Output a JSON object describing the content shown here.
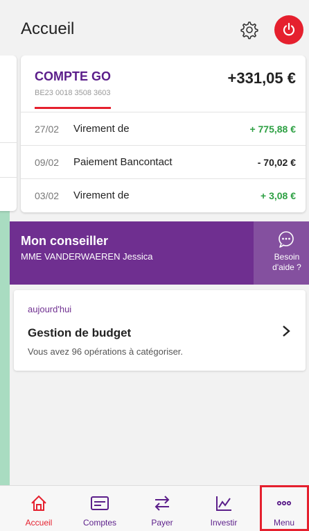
{
  "header": {
    "title": "Accueil",
    "settings_icon": "gear-icon",
    "logout_icon": "power-icon"
  },
  "account": {
    "name": "COMPTE GO",
    "iban": "BE23 0018 3508 3603",
    "balance": "+331,05 €",
    "transactions": [
      {
        "date": "27/02",
        "label": "Virement de",
        "amount": "+ 775,88 €",
        "sign": "positive"
      },
      {
        "date": "09/02",
        "label": "Paiement Bancontact",
        "amount": "- 70,02 €",
        "sign": "negative"
      },
      {
        "date": "03/02",
        "label": "Virement de",
        "amount": "+ 3,08 €",
        "sign": "positive"
      }
    ]
  },
  "advisor": {
    "title": "Mon conseiller",
    "name": "MME VANDERWAEREN Jessica",
    "help_label_line1": "Besoin",
    "help_label_line2": "d'aide ?"
  },
  "budget": {
    "when": "aujourd'hui",
    "title": "Gestion de budget",
    "subtitle": "Vous avez 96 opérations à catégoriser."
  },
  "nav": {
    "items": [
      {
        "label": "Accueil",
        "icon": "home-icon",
        "active": true
      },
      {
        "label": "Comptes",
        "icon": "card-icon",
        "active": false
      },
      {
        "label": "Payer",
        "icon": "transfer-icon",
        "active": false
      },
      {
        "label": "Investir",
        "icon": "chart-icon",
        "active": false
      },
      {
        "label": "Menu",
        "icon": "more-icon",
        "active": false
      }
    ]
  },
  "colors": {
    "accent": "#e5202e",
    "brand": "#6f2f90",
    "positive": "#2da043"
  }
}
